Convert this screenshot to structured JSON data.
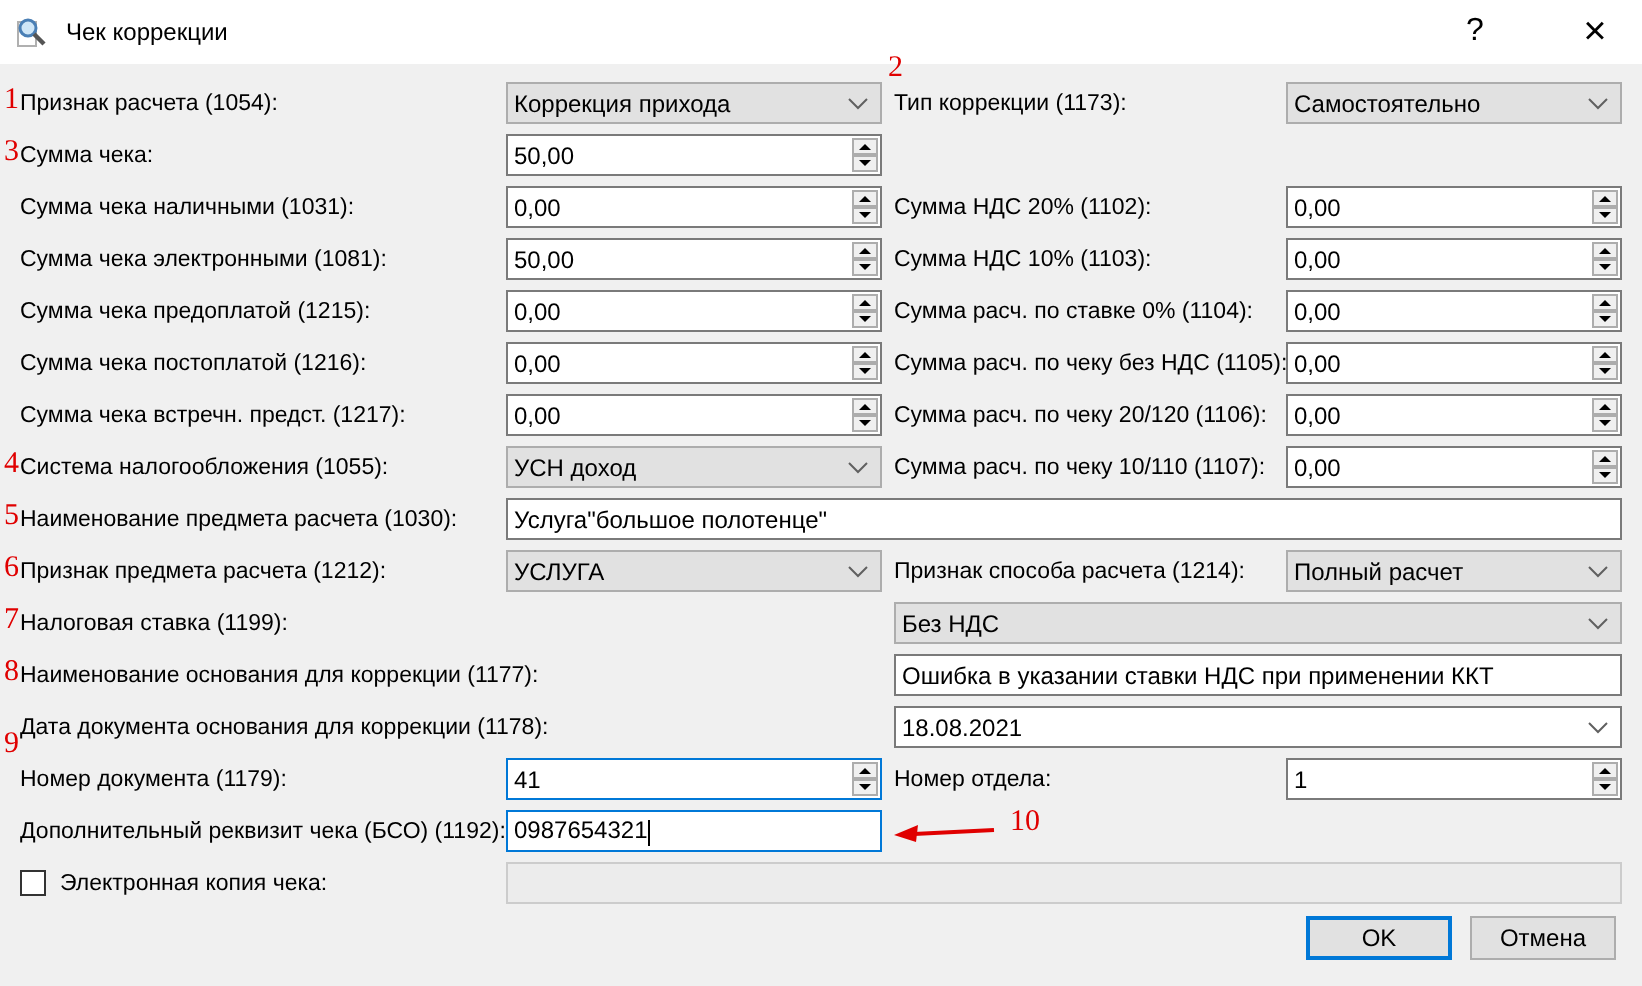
{
  "window": {
    "title": "Чек коррекции",
    "help": "?",
    "close": "×"
  },
  "rows": [
    {
      "kind": "pair",
      "left": {
        "marker": "1",
        "label": "Признак расчета (1054):",
        "control": {
          "kind": "combo",
          "value": "Коррекция прихода"
        }
      },
      "right": {
        "marker": "2",
        "marker_above": true,
        "label": "Тип коррекции (1173):",
        "control": {
          "kind": "combo",
          "value": "Самостоятельно"
        }
      }
    },
    {
      "kind": "pair",
      "left": {
        "marker": "3",
        "label": "Сумма чека:",
        "control": {
          "kind": "spin",
          "value": "50,00"
        }
      }
    },
    {
      "kind": "pair",
      "left": {
        "label": "Сумма чека наличными (1031):",
        "control": {
          "kind": "spin",
          "value": "0,00"
        }
      },
      "right": {
        "label": "Сумма НДС 20% (1102):",
        "control": {
          "kind": "spin",
          "value": "0,00"
        }
      }
    },
    {
      "kind": "pair",
      "left": {
        "label": "Сумма чека электронными (1081):",
        "control": {
          "kind": "spin",
          "value": "50,00"
        }
      },
      "right": {
        "label": "Сумма НДС 10% (1103):",
        "control": {
          "kind": "spin",
          "value": "0,00"
        }
      }
    },
    {
      "kind": "pair",
      "left": {
        "label": "Сумма чека предоплатой (1215):",
        "control": {
          "kind": "spin",
          "value": "0,00"
        }
      },
      "right": {
        "label": "Сумма расч. по ставке 0% (1104):",
        "control": {
          "kind": "spin",
          "value": "0,00"
        }
      }
    },
    {
      "kind": "pair",
      "left": {
        "label": "Сумма чека постоплатой (1216):",
        "control": {
          "kind": "spin",
          "value": "0,00"
        }
      },
      "right": {
        "label": "Сумма расч. по чеку без НДС (1105):",
        "control": {
          "kind": "spin",
          "value": "0,00"
        }
      }
    },
    {
      "kind": "pair",
      "left": {
        "label": "Сумма чека встречн. предст. (1217):",
        "control": {
          "kind": "spin",
          "value": "0,00"
        }
      },
      "right": {
        "label": "Сумма расч. по чеку 20/120 (1106):",
        "control": {
          "kind": "spin",
          "value": "0,00"
        }
      }
    },
    {
      "kind": "pair",
      "left": {
        "marker": "4",
        "label": "Система налогообложения (1055):",
        "control": {
          "kind": "combo",
          "value": "УСН доход"
        }
      },
      "right": {
        "label": "Сумма расч. по чеку 10/110 (1107):",
        "control": {
          "kind": "spin",
          "value": "0,00"
        }
      }
    },
    {
      "kind": "wide",
      "left": {
        "marker": "5",
        "label": "Наименование предмета расчета (1030):",
        "control": {
          "kind": "text",
          "value": "Услуга\"большое полотенце\""
        }
      }
    },
    {
      "kind": "pair",
      "left": {
        "marker": "6",
        "label": "Признак предмета расчета (1212):",
        "control": {
          "kind": "combo",
          "value": "УСЛУГА"
        }
      },
      "right": {
        "label": "Признак способа расчета (1214):",
        "control": {
          "kind": "combo",
          "value": "Полный расчет"
        }
      }
    },
    {
      "kind": "long",
      "left": {
        "marker": "7",
        "label": "Налоговая ставка (1199):",
        "control": {
          "kind": "combo",
          "value": "Без НДС"
        }
      }
    },
    {
      "kind": "long",
      "left": {
        "marker": "8",
        "label": "Наименование основания для коррекции (1177):",
        "control": {
          "kind": "text",
          "value": "Ошибка в указании ставки НДС при применении ККТ"
        }
      }
    },
    {
      "kind": "long",
      "left": {
        "label": "Дата документа основания для коррекции (1178):",
        "control": {
          "kind": "date",
          "value": "18.08.2021"
        }
      }
    },
    {
      "kind": "pair",
      "left": {
        "marker": "9",
        "marker_above": true,
        "label": "Номер документа (1179):",
        "control": {
          "kind": "spin",
          "value": "41",
          "focused": true
        }
      },
      "right": {
        "label": "Номер отдела:",
        "control": {
          "kind": "spin",
          "value": "1"
        }
      }
    },
    {
      "kind": "pair",
      "left": {
        "label": "Дополнительный реквизит чека (БСО) (1192):",
        "control": {
          "kind": "text",
          "value": "0987654321",
          "focused": true
        }
      },
      "annotation": {
        "label": "10"
      }
    },
    {
      "kind": "check",
      "checked": false,
      "left": {
        "label": "Электронная копия чека:",
        "control": {
          "kind": "text",
          "disabled": true
        }
      }
    }
  ],
  "buttons": [
    {
      "label": "OK",
      "focused": true
    },
    {
      "label": "Отмена",
      "focused": false
    }
  ]
}
